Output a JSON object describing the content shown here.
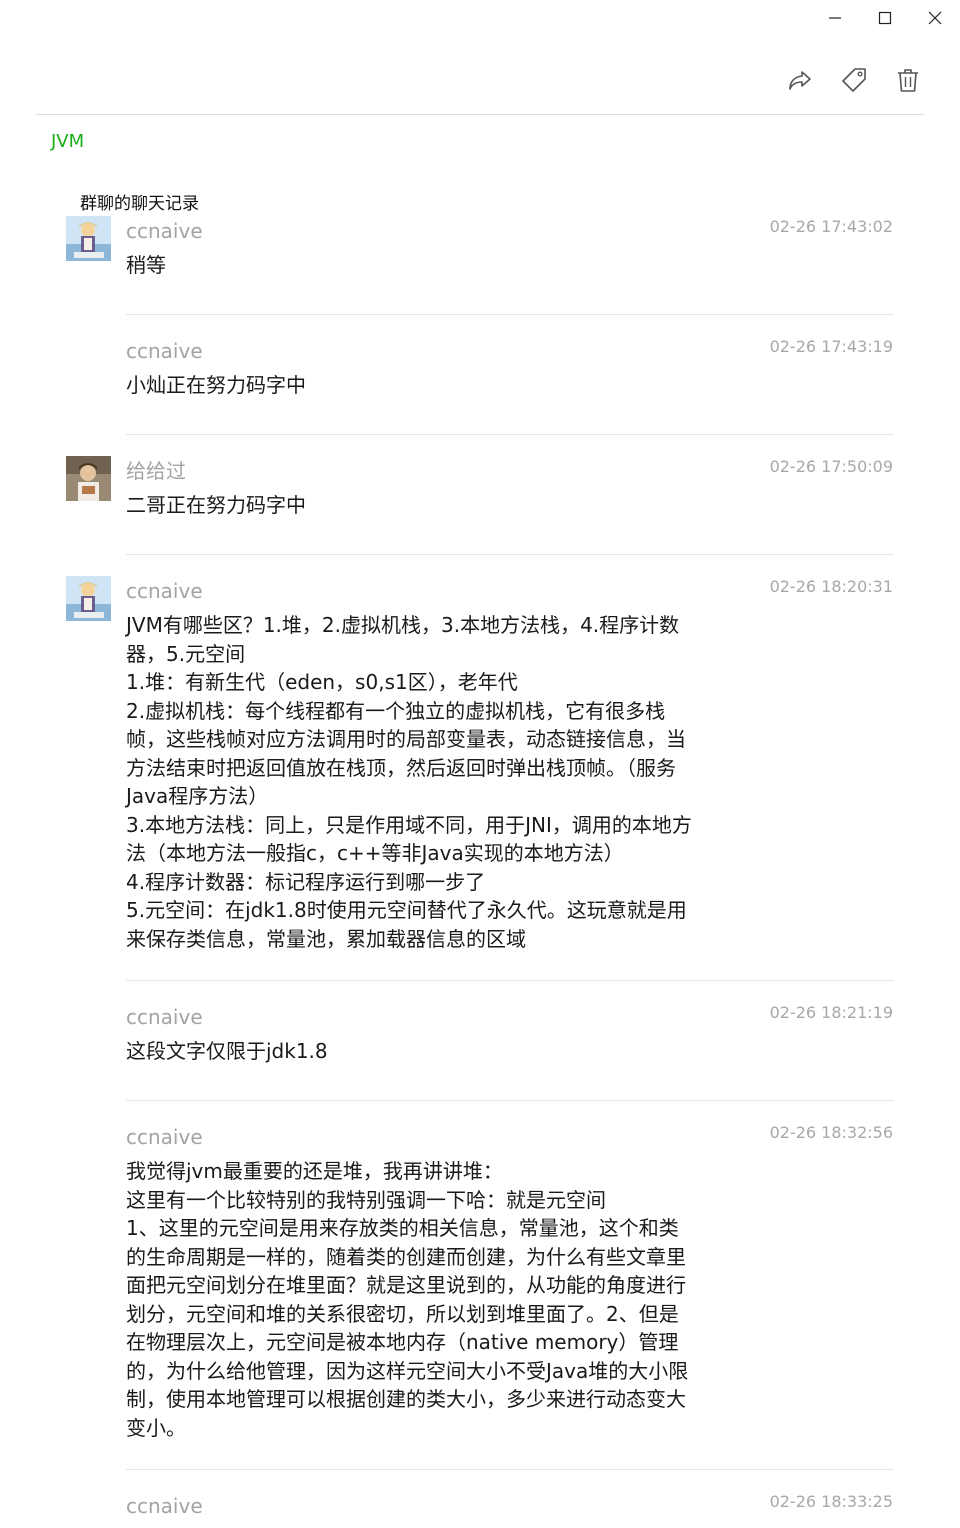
{
  "window": {
    "controls": [
      "minimize",
      "maximize",
      "close"
    ]
  },
  "toolbar": {
    "icons": [
      "share-icon",
      "tag-icon",
      "trash-icon"
    ]
  },
  "tag": "JVM",
  "record_title": "群聊的聊天记录",
  "colors": {
    "tag": "#1aad19",
    "sender": "#a3a3a3",
    "time": "#a8a8a8",
    "text": "#1a1a1a",
    "divider": "#e5e5e5"
  },
  "messages": [
    {
      "sender": "ccnaive",
      "time": "02-26 17:43:02",
      "avatar": "avatar-ccnaive",
      "content": "稍等"
    },
    {
      "sender": "ccnaive",
      "time": "02-26 17:43:19",
      "avatar": "",
      "content": "小灿正在努力码字中"
    },
    {
      "sender": "给给过",
      "time": "02-26 17:50:09",
      "avatar": "avatar-geigeiguo",
      "content": "二哥正在努力码字中"
    },
    {
      "sender": "ccnaive",
      "time": "02-26 18:20:31",
      "avatar": "avatar-ccnaive",
      "content": "JVM有哪些区？1.堆，2.虚拟机栈，3.本地方法栈，4.程序计数\n器，5.元空间\n1.堆：有新生代（eden，s0,s1区），老年代\n2.虚拟机栈：每个线程都有一个独立的虚拟机栈，它有很多栈\n帧，这些栈帧对应方法调用时的局部变量表，动态链接信息，当\n方法结束时把返回值放在栈顶，然后返回时弹出栈顶帧。（服务\nJava程序方法）\n3.本地方法栈：同上，只是作用域不同，用于JNI，调用的本地方\n法（本地方法一般指c，c++等非Java实现的本地方法）\n4.程序计数器：标记程序运行到哪一步了\n5.元空间：在jdk1.8时使用元空间替代了永久代。这玩意就是用\n来保存类信息，常量池，累加载器信息的区域"
    },
    {
      "sender": "ccnaive",
      "time": "02-26 18:21:19",
      "avatar": "",
      "content": "这段文字仅限于jdk1.8"
    },
    {
      "sender": "ccnaive",
      "time": "02-26 18:32:56",
      "avatar": "",
      "content": "我觉得jvm最重要的还是堆，我再讲讲堆：\n这里有一个比较特别的我特别强调一下哈：就是元空间\n1、这里的元空间是用来存放类的相关信息，常量池，这个和类\n的生命周期是一样的，随着类的创建而创建，为什么有些文章里\n面把元空间划分在堆里面？就是这里说到的，从功能的角度进行\n划分，元空间和堆的关系很密切，所以划到堆里面了。2、但是\n在物理层次上，元空间是被本地内存（native memory）管理\n的，为什么给他管理，因为这样元空间大小不受Java堆的大小限\n制，使用本地管理可以根据创建的类大小，多少来进行动态变大\n变小。"
    },
    {
      "sender": "ccnaive",
      "time": "02-26 18:33:25",
      "avatar": "",
      "content": ""
    }
  ]
}
